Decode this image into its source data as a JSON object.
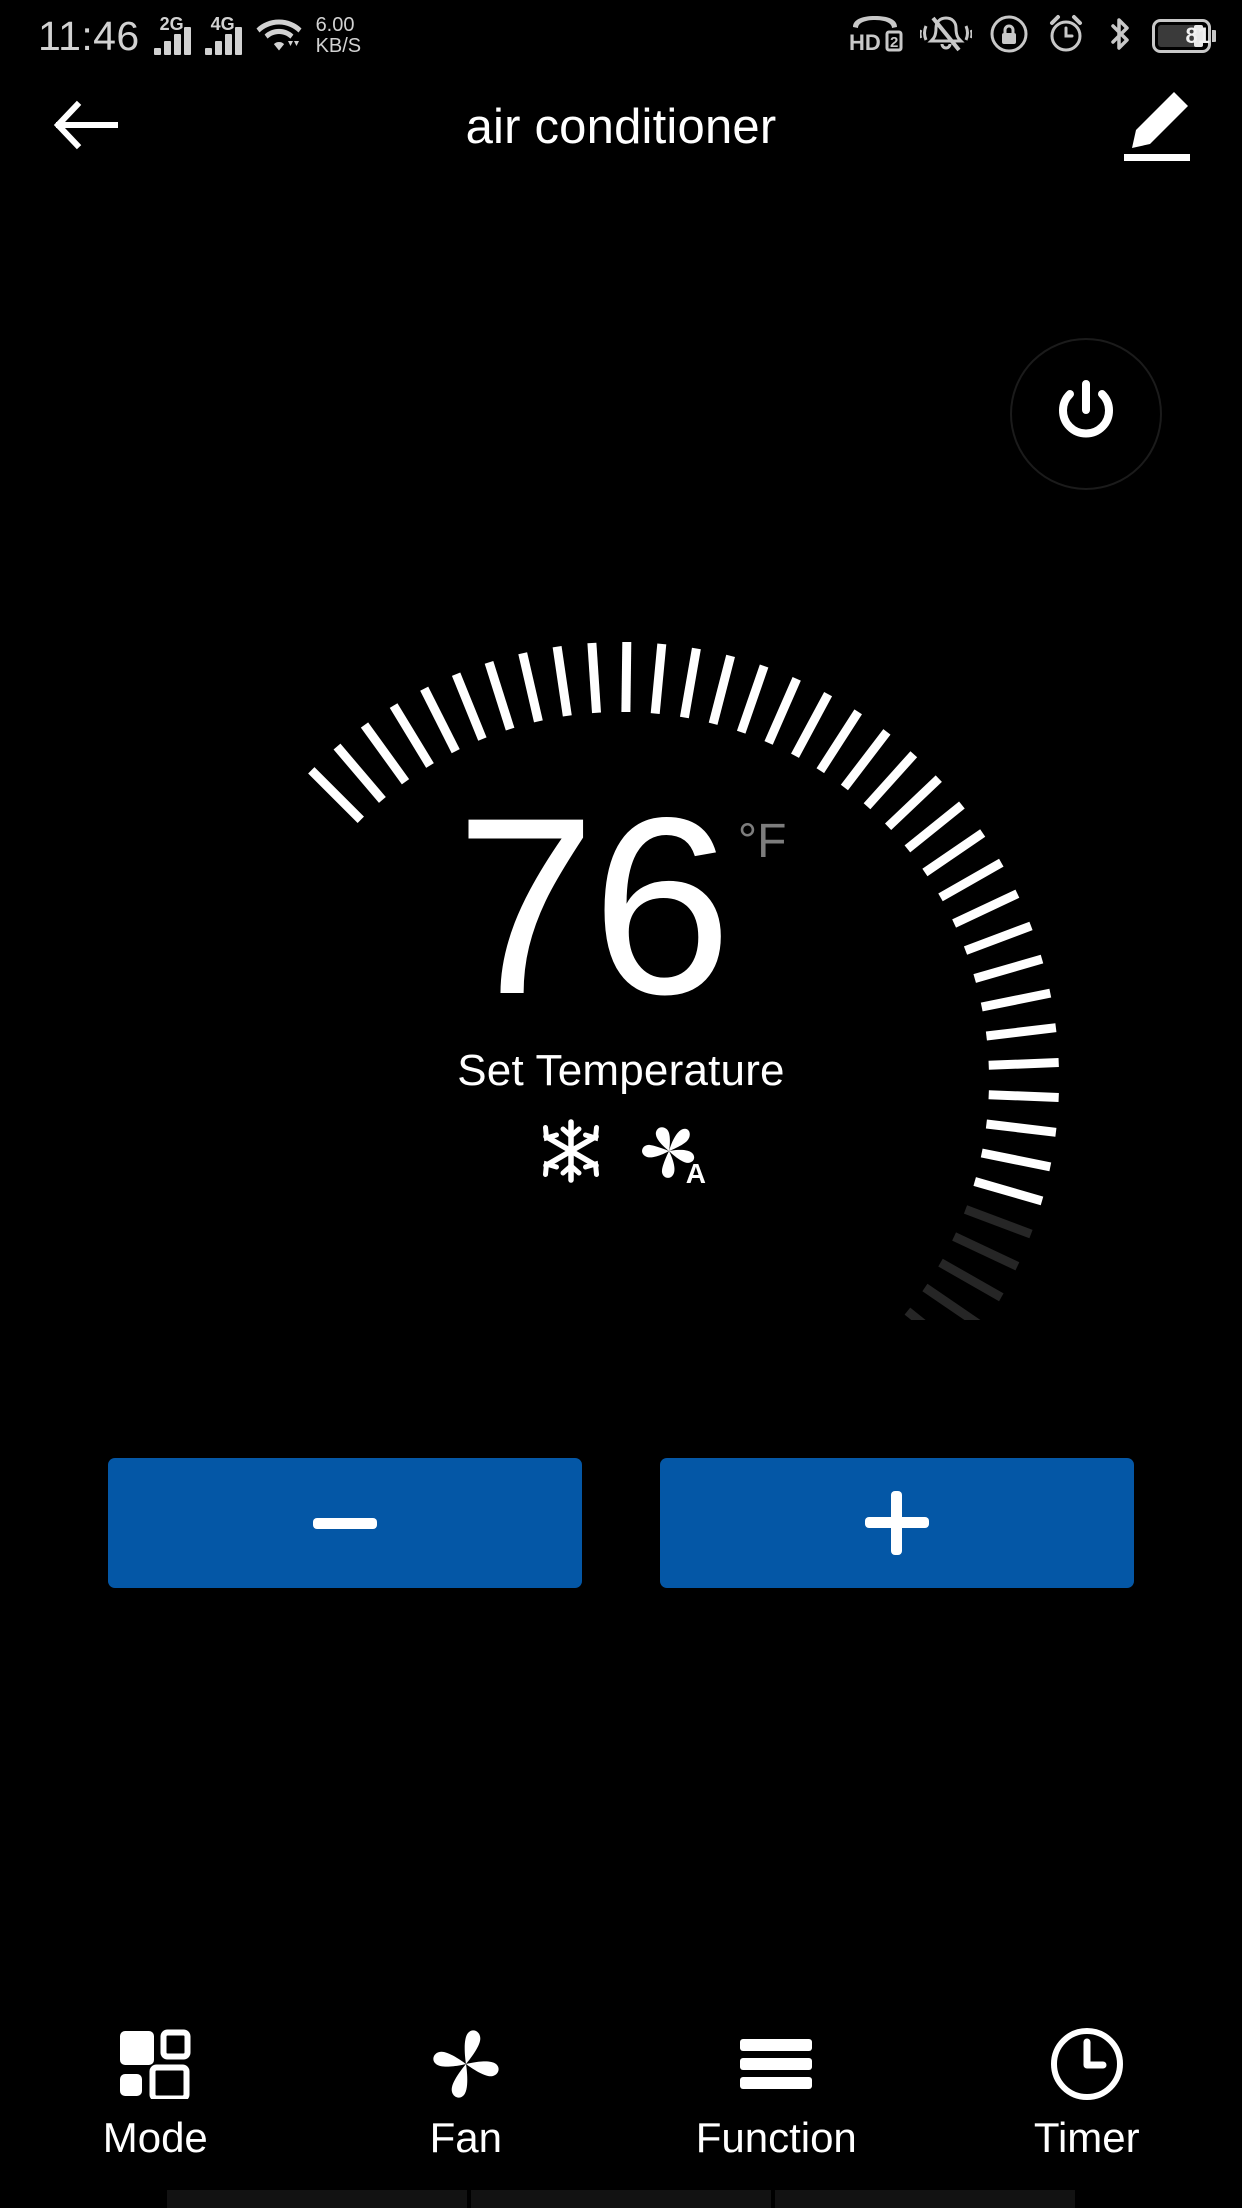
{
  "status_bar": {
    "time": "11:46",
    "sim1_generation": "2G",
    "sim2_generation": "4G",
    "network_speed_value": "6.00",
    "network_speed_unit": "KB/S",
    "battery_percent": "81",
    "icons": {
      "sim1": "signal-bars-icon",
      "sim2": "signal-bars-icon",
      "wifi": "wifi-icon",
      "volte": "volte-hd2-icon",
      "silent": "bell-mute-icon",
      "rotation_lock": "rotation-lock-icon",
      "alarm": "alarm-clock-icon",
      "bluetooth": "bluetooth-icon",
      "battery": "battery-icon"
    }
  },
  "header": {
    "title": "air conditioner",
    "back_icon": "arrow-left-icon",
    "edit_icon": "pencil-edit-icon"
  },
  "power": {
    "icon": "power-icon",
    "label": "Power"
  },
  "dial": {
    "temperature": "76",
    "unit": "°F",
    "label": "Set Temperature",
    "mode_icon": "snowflake-icon",
    "fan_icon": "fan-auto-icon",
    "fan_auto_letter": "A",
    "total_ticks": 60,
    "active_ticks": 34,
    "active_color": "#ffffff",
    "inactive_color": "#262626"
  },
  "stepper": {
    "decrease_label": "−",
    "increase_label": "+",
    "decrease_icon": "minus-icon",
    "increase_icon": "plus-icon",
    "button_color": "#0457a6"
  },
  "bottom_nav": {
    "items": [
      {
        "label": "Mode",
        "icon": "mode-grid-icon"
      },
      {
        "label": "Fan",
        "icon": "fan-icon"
      },
      {
        "label": "Function",
        "icon": "hamburger-lines-icon"
      },
      {
        "label": "Timer",
        "icon": "clock-icon"
      }
    ]
  },
  "system_nav": {
    "keys": [
      "recents-key",
      "home-key",
      "back-key"
    ]
  }
}
